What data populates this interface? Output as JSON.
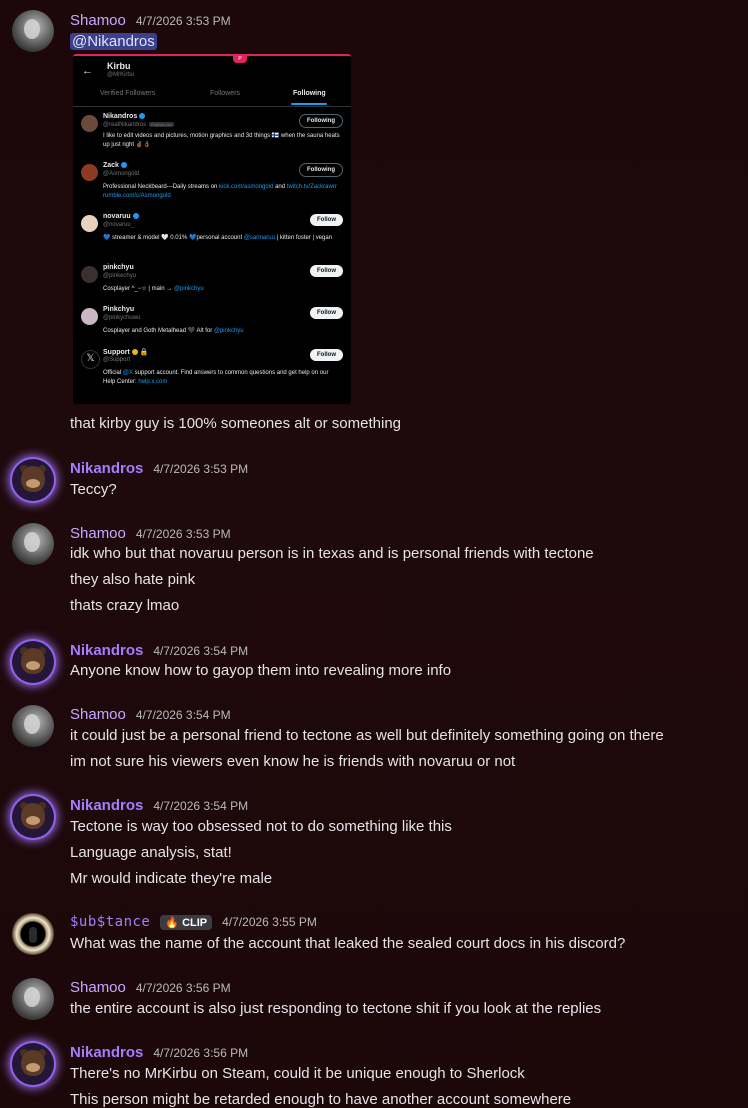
{
  "messages": [
    {
      "author": "Shamoo",
      "time": "4/7/2026 3:53 PM",
      "mention": "@Nikandros",
      "lines": [
        "that kirby guy is 100% someones alt or something"
      ]
    },
    {
      "author": "Nikandros",
      "time": "4/7/2026 3:53 PM",
      "lines": [
        "Teccy?"
      ]
    },
    {
      "author": "Shamoo",
      "time": "4/7/2026 3:53 PM",
      "lines": [
        "idk who but that novaruu person is in texas and is personal friends with tectone",
        "they also hate pink",
        "thats crazy lmao"
      ]
    },
    {
      "author": "Nikandros",
      "time": "4/7/2026 3:54 PM",
      "lines": [
        "Anyone know how to gayop them into revealing more info"
      ]
    },
    {
      "author": "Shamoo",
      "time": "4/7/2026 3:54 PM",
      "lines": [
        "it could just be a personal friend to tectone as well but definitely something going on there",
        "im not sure his viewers even know he is friends with novaruu or not"
      ]
    },
    {
      "author": "Nikandros",
      "time": "4/7/2026 3:54 PM",
      "lines": [
        "Tectone is way too obsessed not to do something like this",
        "Language analysis, stat!",
        "Mr would indicate they're male"
      ]
    },
    {
      "author": "$ub$tance",
      "tag": "CLIP",
      "time": "4/7/2026 3:55 PM",
      "lines": [
        "What was the name of the account that leaked the sealed court docs in his discord?"
      ]
    },
    {
      "author": "Shamoo",
      "time": "4/7/2026 3:56 PM",
      "lines": [
        "the entire account is also just responding to tectone shit if you look at the replies"
      ]
    },
    {
      "author": "Nikandros",
      "time": "4/7/2026 3:56 PM",
      "lines": [
        "There's no MrKirbu on Steam, could it be unique enough to Sherlock",
        "This person might be retarded enough to have another account somewhere"
      ]
    }
  ],
  "embed": {
    "title": "Kirbu",
    "handle": "@MrKirbu",
    "tabs": [
      "Verified Followers",
      "Followers",
      "Following"
    ],
    "active_tab": "Following",
    "accounts": [
      {
        "name": "Nikandros",
        "handle": "@realNikandros",
        "follows_you": "Follows you",
        "bio": "I like to edit videos and pictures, motion graphics and 3d things 🇫🇮 when the sauna heats up just right ✌🏾👌🏾",
        "button": "Following"
      },
      {
        "name": "Zack",
        "handle": "@Asmongold",
        "bio_pre": "Professional Neckbeard---Daily streams on ",
        "bio_link1": "kick.com/asmongold",
        "bio_mid": " and ",
        "bio_link2": "twitch.tv/Zackrawrr rumble.com/c/Asmongold",
        "button": "Following"
      },
      {
        "name": "novaruu",
        "handle": "@novaruu_",
        "bio_pre": "💙 streamer & model 🤍 0.01% 💙personal account ",
        "bio_link1": "@sarinaruu",
        "bio_mid": " | kitten foster | vegan",
        "button": "Follow"
      },
      {
        "name": "pinkchyu",
        "handle": "@pinkechyu",
        "bio_pre": "Cosplayer ^_−☆ | main → ",
        "bio_link1": "@pinkchyu",
        "button": "Follow"
      },
      {
        "name": "Pinkchyu",
        "handle": "@pinkychuwu",
        "bio_pre": "Cosplayer and Goth Metalhead 🖤 Alt for ",
        "bio_link1": "@pinkchyu",
        "button": "Follow"
      },
      {
        "name": "Support",
        "handle": "@Support",
        "bio_pre": "Official ",
        "bio_link1": "@X",
        "bio_mid": " support account. Find answers to common questions and get help on our Help Center: ",
        "bio_link2": "help.x.com",
        "button": "Follow"
      }
    ]
  }
}
